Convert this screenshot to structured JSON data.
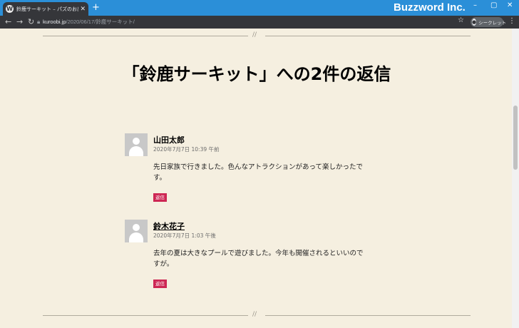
{
  "browser": {
    "tab_title": "鈴鹿サーキット – パズのお出かけブログ",
    "tab_favicon": "W",
    "new_tab": "+",
    "close_tab": "✕",
    "brand": "Buzzword Inc.",
    "window_controls": {
      "minimize": "–",
      "maximize": "▢",
      "close": "✕"
    },
    "nav": {
      "back": "←",
      "forward": "→",
      "reload": "↻"
    },
    "url_host": "kuroobi.jp",
    "url_path": "/2020/06/17/鈴鹿サーキット/",
    "star": "☆",
    "incognito_label": "シークレット",
    "menu": "⋮"
  },
  "separator_mark": "//",
  "heading": "「鈴鹿サーキット」への2件の返信",
  "comments": [
    {
      "author": "山田太郎",
      "date": "2020年7月7日 10:39 午前",
      "text": "先日家族で行きました。色んなアトラクションがあって楽しかったです。",
      "reply": "返信"
    },
    {
      "author": "鈴木花子",
      "date": "2020年7月7日 1:03 午後",
      "text": "去年の夏は大きなプールで遊びました。今年も開催されるといいのですが。",
      "reply": "返信"
    }
  ]
}
